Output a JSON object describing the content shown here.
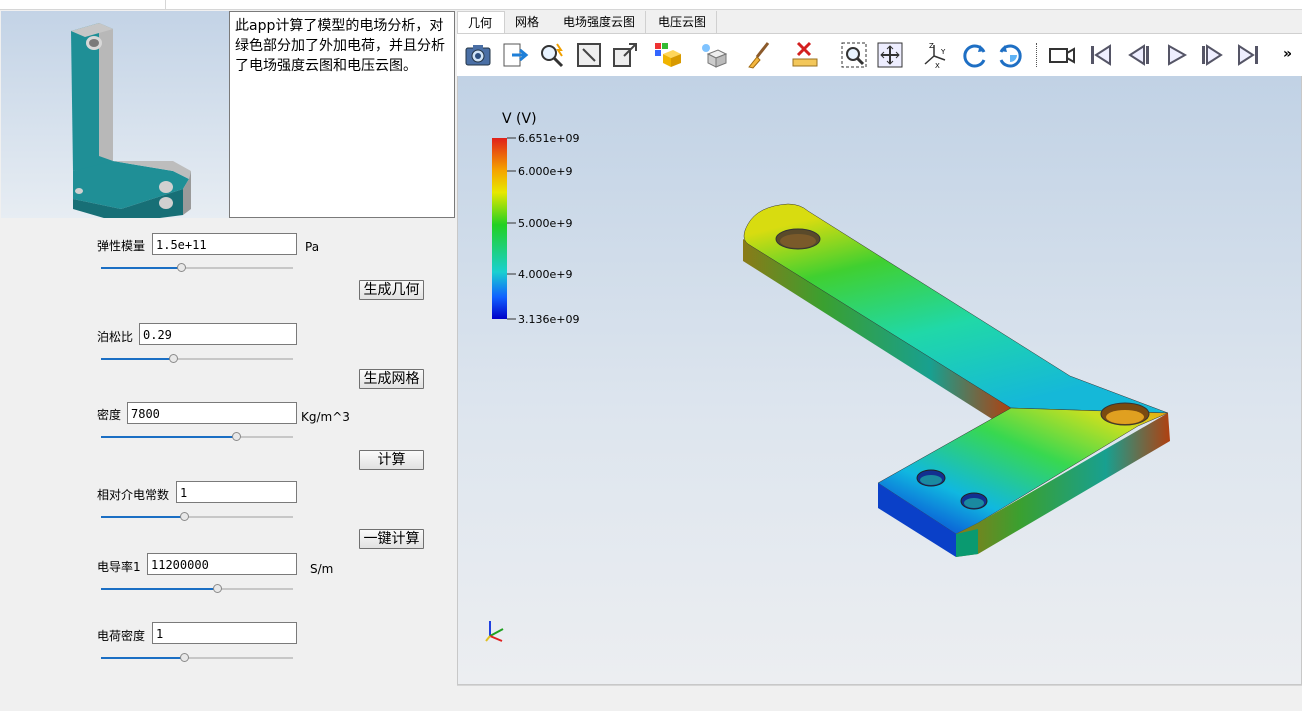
{
  "description": "此app计算了模型的电场分析，对绿色部分加了外加电荷，并且分析了电场强度云图和电压云图。",
  "params": [
    {
      "label": "弹性模量",
      "value": "1.5e+11",
      "unit": "Pa",
      "slider_fraction": 0.42
    },
    {
      "label": "泊松比",
      "value": "0.29",
      "unit": "",
      "slider_fraction": 0.38
    },
    {
      "label": "密度",
      "value": "7800",
      "unit": "Kg/m^3",
      "slider_fraction": 0.71
    },
    {
      "label": "相对介电常数",
      "value": "1",
      "unit": "",
      "slider_fraction": 0.44
    },
    {
      "label": "电导率1",
      "value": "11200000",
      "unit": "S/m",
      "slider_fraction": 0.61
    },
    {
      "label": "电荷密度",
      "value": "1",
      "unit": "",
      "slider_fraction": 0.44
    }
  ],
  "buttons": {
    "gen_geometry": "生成几何",
    "gen_mesh": "生成网格",
    "compute": "计算",
    "one_click": "一键计算"
  },
  "tabs": [
    "几何",
    "网格",
    "电场强度云图",
    "电压云图"
  ],
  "active_tab": "几何",
  "toolbar_icons": [
    "camera-icon",
    "export-icon",
    "magnify-icon",
    "box-select-icon",
    "box-arrow-icon",
    "color-cube-icon",
    "light-cube-icon",
    "brush-icon",
    "ruler-delete-icon",
    "zoom-box-icon",
    "fit-view-icon",
    "axes-icon",
    "rotate-cw-icon",
    "rotate-ccw-icon",
    "video-camera-icon",
    "first-frame-icon",
    "prev-frame-icon",
    "play-icon",
    "next-frame-icon",
    "last-frame-icon",
    "more-icon"
  ],
  "overflow_label": "»",
  "legend": {
    "title": "V (V)",
    "max_label": "6.651e+09",
    "ticks": [
      "6.000e+9",
      "5.000e+9",
      "4.000e+9"
    ],
    "min_label": "3.136e+09",
    "colors": [
      "#e0201a",
      "#f5a400",
      "#e8e800",
      "#22d022",
      "#1ad0d0",
      "#1060ff",
      "#0000c8"
    ]
  }
}
